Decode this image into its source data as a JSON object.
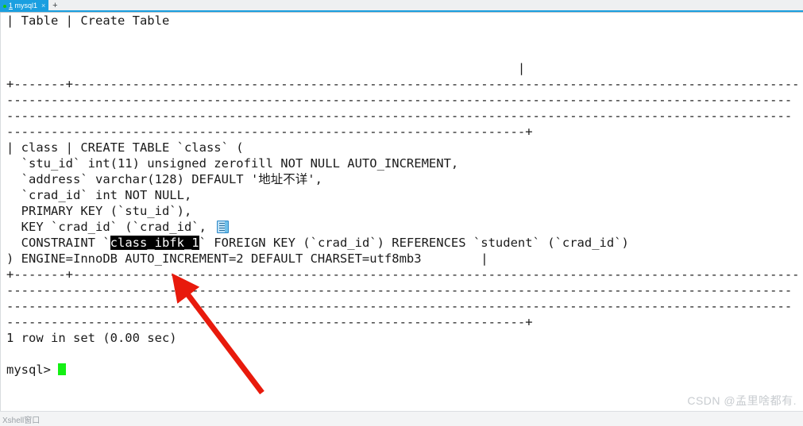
{
  "window": {
    "app": "Xshell",
    "status_text": "Xshell窗口"
  },
  "tabbar": {
    "active_tab": {
      "number": "1",
      "name": " mysql1",
      "close_label": "×"
    },
    "new_tab_label": "+"
  },
  "terminal": {
    "lines": [
      "| Table | Create Table",
      "",
      "",
      "                                                                     |",
      "+-------+--------------------------------------------------------------------------------------------------",
      "----------------------------------------------------------------------------------------------------------",
      "----------------------------------------------------------------------------------------------------------",
      "----------------------------------------------------------------------+",
      "| class | CREATE TABLE `class` (",
      "  `stu_id` int(11) unsigned zerofill NOT NULL AUTO_INCREMENT,",
      "  `address` varchar(128) DEFAULT '地址不详',",
      "  `crad_id` int NOT NULL,",
      "  PRIMARY KEY (`stu_id`),",
      "  KEY `crad_id` (`crad_id`),",
      "  CONSTRAINT `class_ibfk_1` FOREIGN KEY (`crad_id`) REFERENCES `student` (`crad_id`)",
      ") ENGINE=InnoDB AUTO_INCREMENT=2 DEFAULT CHARSET=utf8mb3        |",
      "+-------+--------------------------------------------------------------------------------------------------",
      "----------------------------------------------------------------------------------------------------------",
      "----------------------------------------------------------------------------------------------------------",
      "----------------------------------------------------------------------+",
      "1 row in set (0.00 sec)",
      "",
      "mysql> "
    ],
    "line_constraint_prefix": "  CONSTRAINT `",
    "line_constraint_selected": "class_ibfk_1",
    "line_constraint_suffix": "` FOREIGN KEY (`crad_id`) REFERENCES `student` (`crad_id`)",
    "line_key_prefix": "  KEY `crad_id` (`crad_id",
    "line_key_suffix": "`,",
    "prompt": "mysql> ",
    "selection_colors": {
      "background": "#000000",
      "foreground": "#ffffff"
    },
    "cursor_color": "#14f014",
    "foreground": "#1b1b1b",
    "background": "#ffffff"
  },
  "annotation": {
    "arrow_color": "#e81a0c",
    "points_at": "AUTO_INCREMENT=2"
  },
  "watermark": {
    "text": "CSDN @孟里啥都有."
  },
  "icons": {
    "paste": "paste-icon"
  }
}
